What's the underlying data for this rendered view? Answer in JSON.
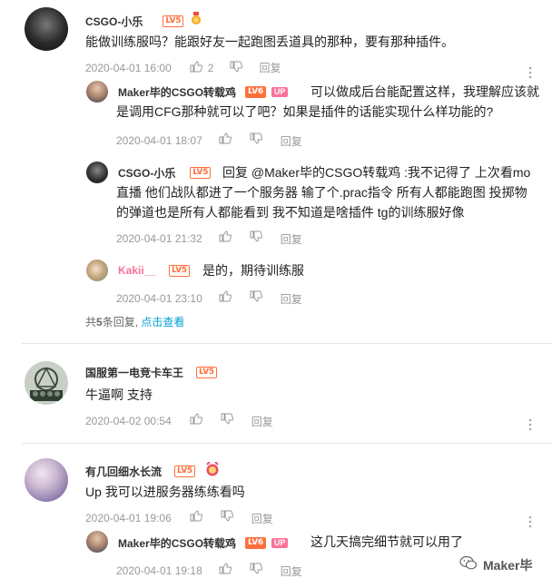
{
  "comments": [
    {
      "user": "CSGO-小乐",
      "level": "LV5",
      "text": "能做训练服吗？能跟好友一起跑图丢道具的那种，要有那种插件。",
      "date": "2020-04-01 16:00",
      "likes": "2",
      "reply_label": "回复",
      "replies": [
        {
          "user": "Maker毕的CSGO转载鸡",
          "level": "LV6",
          "badge": "UP",
          "text_line1": "可以做成后台能配置这样，我理解应该就",
          "text_line2": "是调用CFG那种就可以了吧？如果是插件的话能实现什么样功能的?",
          "date": "2020-04-01 18:07",
          "reply_label": "回复"
        },
        {
          "user": "CSGO-小乐",
          "level": "LV5",
          "text_line1": "回复 @Maker毕的CSGO转载鸡 :我不记得了 上次看mo",
          "text_line2": "直播 他们战队都进了一个服务器 输了个.prac指令 所有人都能跑图 投掷物",
          "text_line3": "的弹道也是所有人都能看到 我不知道是啥插件 tg的训练服好像",
          "date": "2020-04-01 21:32",
          "reply_label": "回复"
        },
        {
          "user": "Kakii__",
          "level": "LV5",
          "text_line1": "是的，期待训练服",
          "date": "2020-04-01 23:10",
          "reply_label": "回复"
        }
      ],
      "summary_prefix": "共",
      "summary_count": "5",
      "summary_suffix": "条回复,",
      "summary_link": "点击查看"
    },
    {
      "user": "国服第一电竞卡车王",
      "level": "LV5",
      "text": "牛逼啊 支持",
      "date": "2020-04-02 00:54",
      "reply_label": "回复"
    },
    {
      "user": "有几回细水长流",
      "level": "LV5",
      "text": "Up 我可以进服务器练练看吗",
      "date": "2020-04-01 19:06",
      "reply_label": "回复",
      "replies": [
        {
          "user": "Maker毕的CSGO转载鸡",
          "level": "LV6",
          "badge": "UP",
          "text_line1": "这几天搞完细节就可以用了",
          "date": "2020-04-01 19:18",
          "reply_label": "回复"
        }
      ]
    }
  ],
  "watermark": "Maker毕",
  "icons": {
    "like": "thumbs-up-icon",
    "dislike": "thumbs-down-icon",
    "more": "more-vertical-icon",
    "medal": "medal-icon",
    "wechat": "wechat-icon"
  },
  "colors": {
    "level": "#ff6f3c",
    "up_badge": "#fb7299",
    "link": "#00a1d6",
    "meta": "#999999"
  }
}
